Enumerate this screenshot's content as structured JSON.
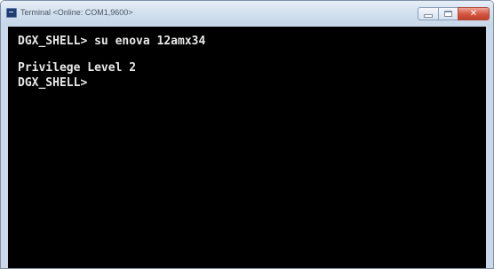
{
  "window": {
    "title": "Terminal <Online: COM1,9600>",
    "close_glyph": "✕"
  },
  "terminal": {
    "lines": [
      "DGX_SHELL> su enova 12amx34",
      "",
      "Privilege Level 2",
      "DGX_SHELL>"
    ]
  },
  "icons": {
    "app": "terminal-app-icon",
    "minimize": "minimize-icon",
    "maximize": "maximize-icon",
    "close": "close-icon"
  },
  "colors": {
    "terminal_background": "#000000",
    "terminal_text": "#e8e8e8",
    "titlebar": "#d3e0ee",
    "close_button": "#d2543d"
  }
}
